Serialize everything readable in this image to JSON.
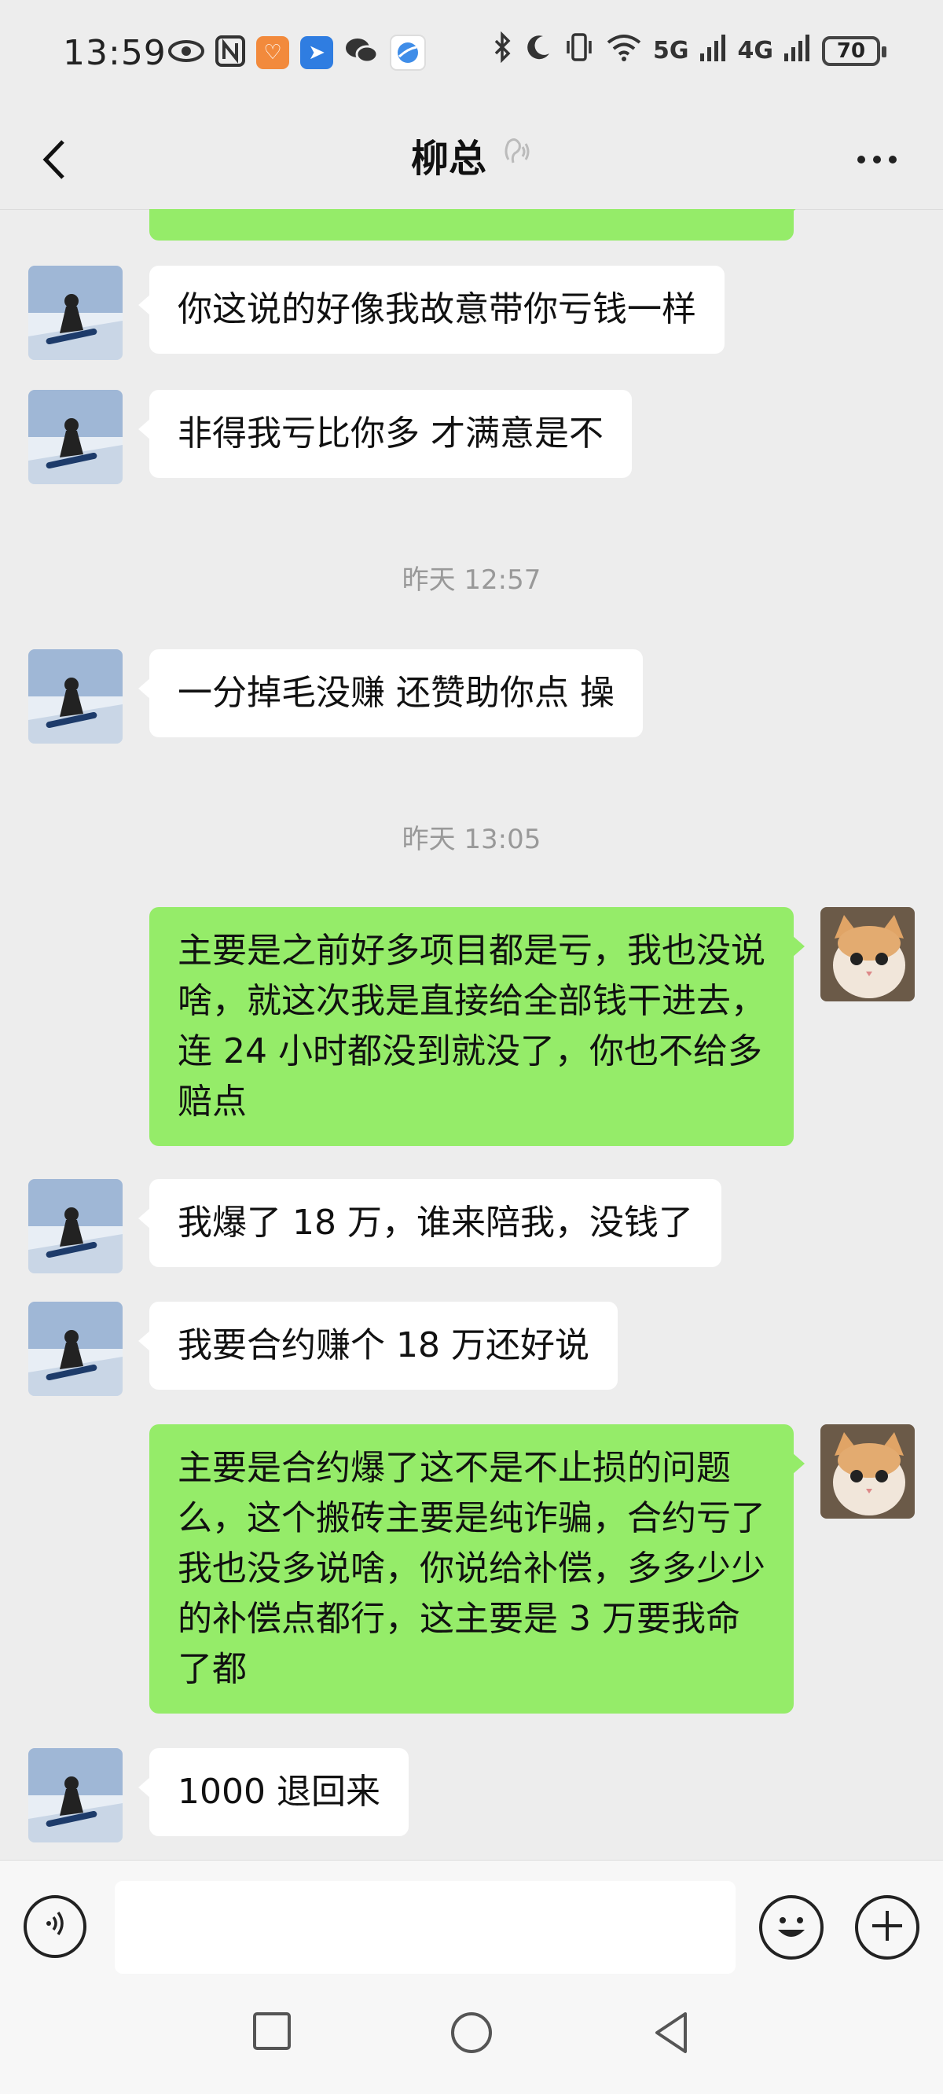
{
  "status_bar": {
    "time": "13:59",
    "network_5g": "5G",
    "network_4g": "4G",
    "battery": "70"
  },
  "header": {
    "title": "柳总"
  },
  "messages": [
    {
      "side": "in",
      "text": "你这说的好像我故意带你亏钱一样"
    },
    {
      "side": "in",
      "text": "非得我亏比你多 才满意是不"
    },
    {
      "type": "time",
      "text": "昨天 12:57"
    },
    {
      "side": "in",
      "text": "一分掉毛没赚 还赞助你点 操"
    },
    {
      "type": "time",
      "text": "昨天 13:05"
    },
    {
      "side": "out",
      "text": "主要是之前好多项目都是亏，我也没说啥，就这次我是直接给全部钱干进去，连 24 小时都没到就没了，你也不给多赔点"
    },
    {
      "side": "in",
      "text": "我爆了 18 万，谁来陪我，没钱了"
    },
    {
      "side": "in",
      "text": "我要合约赚个 18 万还好说"
    },
    {
      "side": "out",
      "text": "主要是合约爆了这不是不止损的问题么，这个搬砖主要是纯诈骗，合约亏了我也没多说啥，你说给补偿，多多少少的补偿点都行，这主要是 3 万要我命了都"
    },
    {
      "side": "in",
      "text": "1000 退回来"
    }
  ],
  "colors": {
    "incoming_bubble": "#ffffff",
    "outgoing_bubble": "#95ec69",
    "background": "#ededed"
  },
  "icons": [
    "eye-icon",
    "nfc-icon",
    "app-orange-icon",
    "app-blue-icon",
    "wechat-icon",
    "browser-icon",
    "bluetooth-icon",
    "moon-icon",
    "vibrate-icon",
    "wifi-icon",
    "signal-icon",
    "back-icon",
    "earpiece-icon",
    "more-icon",
    "voice-icon",
    "emoji-icon",
    "plus-icon",
    "nav-square-icon",
    "nav-circle-icon",
    "nav-back-icon"
  ]
}
